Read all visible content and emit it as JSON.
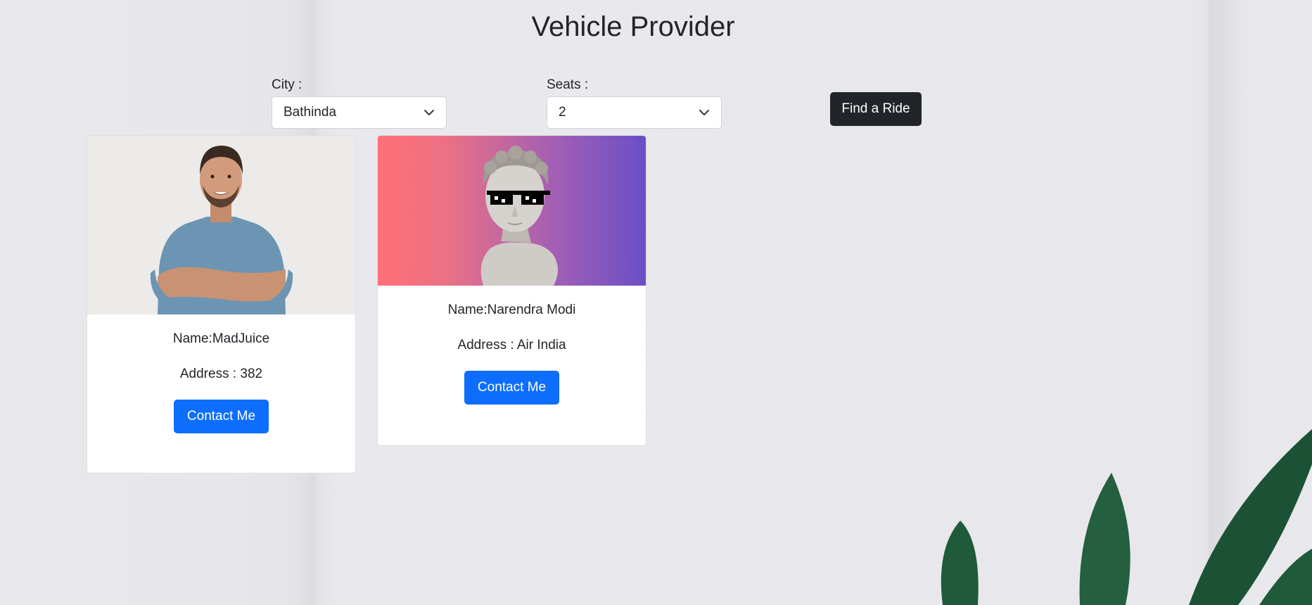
{
  "page": {
    "title": "Vehicle Provider"
  },
  "filters": {
    "city_label": "City :",
    "city_value": "Bathinda",
    "seats_label": "Seats :",
    "seats_value": "2",
    "find_button_label": "Find a Ride"
  },
  "providers": [
    {
      "name": "Name:MadJuice",
      "address": "Address : 382",
      "contact_label": "Contact Me",
      "image": "man-portrait-photo"
    },
    {
      "name": "Name:Narendra Modi",
      "address": "Address : Air India",
      "contact_label": "Contact Me",
      "image": "statue-with-sunglasses"
    }
  ],
  "colors": {
    "primary": "#0d6efd",
    "dark": "#212529",
    "background": "#e9e8ec",
    "gradient_start": "#ff6f76",
    "gradient_end": "#6a4fc7",
    "plant": "#1f5a3a"
  }
}
